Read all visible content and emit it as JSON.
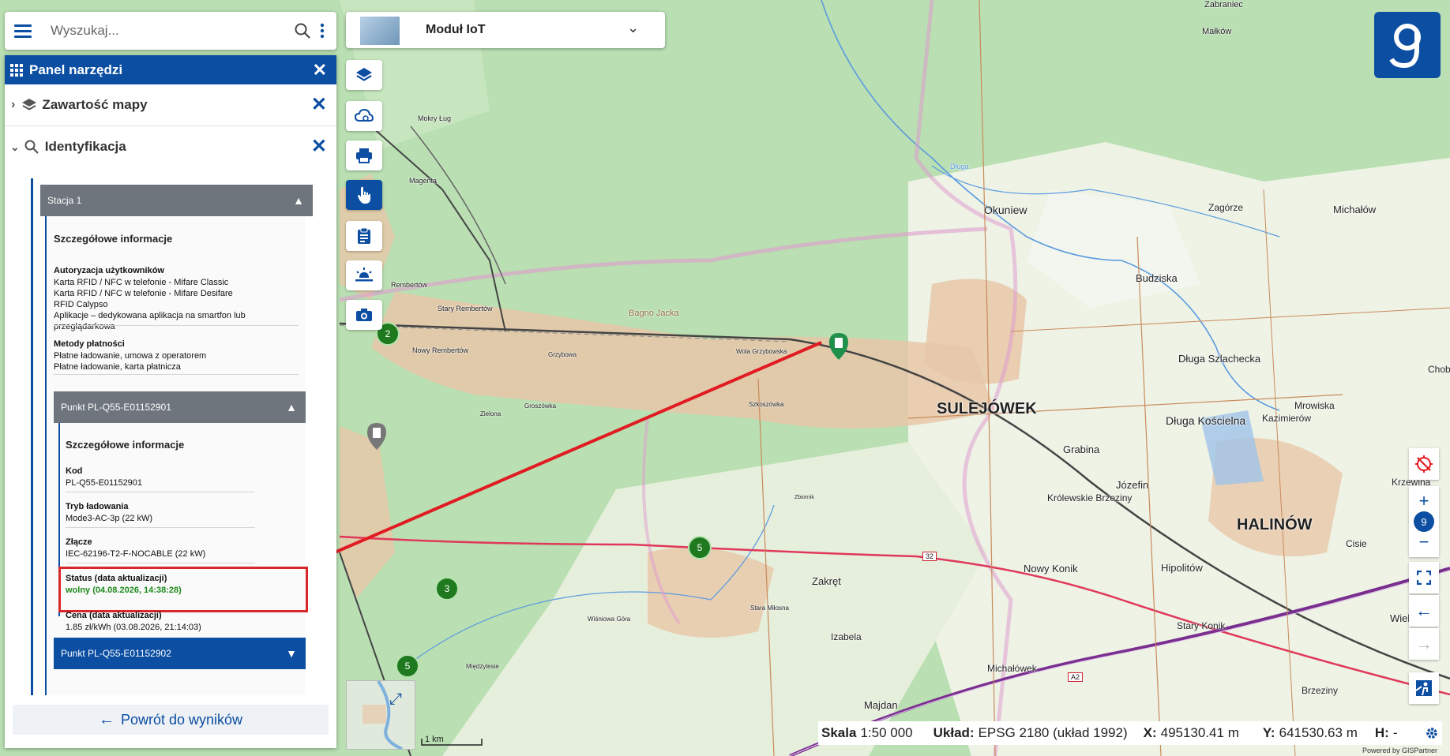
{
  "search": {
    "placeholder": "Wyszukaj..."
  },
  "panel": {
    "title": "Panel narzędzi",
    "sections": [
      {
        "label": "Zawartość mapy"
      },
      {
        "label": "Identyfikacja"
      }
    ],
    "station": {
      "title": "Stacja 1",
      "details_title": "Szczegółowe informacje",
      "auth_label": "Autoryzacja użytkowników",
      "auth_values": [
        "Karta RFID / NFC w telefonie - Mifare Classic",
        "Karta RFID / NFC w telefonie - Mifare Desifare",
        "RFID Calypso",
        "Aplikacje – dedykowana aplikacja na smartfon lub przeglądarkowa"
      ],
      "payment_label": "Metody płatności",
      "payment_values": [
        "Płatne ładowanie, umowa z operatorem",
        "Płatne ładowanie, karta płatnicza"
      ]
    },
    "point1": {
      "title": "Punkt PL-Q55-E01152901",
      "details_title": "Szczegółowe informacje",
      "fields": [
        {
          "label": "Kod",
          "value": "PL-Q55-E01152901"
        },
        {
          "label": "Tryb ładowania",
          "value": "Mode3-AC-3p (22 kW)"
        },
        {
          "label": "Złącze",
          "value": "IEC-62196-T2-F-NOCABLE (22 kW)"
        },
        {
          "label": "Status (data aktualizacji)",
          "value": "wolny (04.08.2026, 14:38:28)"
        },
        {
          "label": "Cena (data aktualizacji)",
          "value": "1.85 zł/kWh (03.08.2026, 21:14:03)"
        }
      ]
    },
    "point2": {
      "title": "Punkt PL-Q55-E01152902"
    },
    "back_label": "Powrót do wyników"
  },
  "module": {
    "label": "Moduł IoT"
  },
  "map": {
    "places": [
      {
        "name": "SULEJÓWEK"
      },
      {
        "name": "HALINÓW"
      },
      {
        "name": "Okuniew"
      },
      {
        "name": "Zagórze"
      },
      {
        "name": "Michałów"
      },
      {
        "name": "Budziska"
      },
      {
        "name": "Długa Szlachecka"
      },
      {
        "name": "Długa Kościelna"
      },
      {
        "name": "Kazimierów"
      },
      {
        "name": "Mrowiska"
      },
      {
        "name": "Grabina"
      },
      {
        "name": "Józefin"
      },
      {
        "name": "Królewskie Brzeziny"
      },
      {
        "name": "Nowy Konik"
      },
      {
        "name": "Hipolitów"
      },
      {
        "name": "Zakręt"
      },
      {
        "name": "Stary Konik"
      },
      {
        "name": "Izabela"
      },
      {
        "name": "Michałówek"
      },
      {
        "name": "Majdan"
      },
      {
        "name": "Brzeziny"
      },
      {
        "name": "Cisie"
      },
      {
        "name": "Wielgo"
      },
      {
        "name": "Krzewina"
      },
      {
        "name": "Chobo"
      },
      {
        "name": "Małków"
      },
      {
        "name": "Zabraniec"
      },
      {
        "name": "Mokry Ług"
      },
      {
        "name": "Magenta"
      },
      {
        "name": "Rembertów"
      },
      {
        "name": "Stary Rembertów"
      },
      {
        "name": "Nowy Rembertów"
      },
      {
        "name": "Bagno Jacka"
      },
      {
        "name": "Grzybowa"
      },
      {
        "name": "Wola Grzybowska"
      },
      {
        "name": "Zielona"
      },
      {
        "name": "Groszówka"
      },
      {
        "name": "Szkoszówka"
      },
      {
        "name": "Stara Miłosna"
      },
      {
        "name": "Wiśniowa Góra"
      },
      {
        "name": "Międzylesie"
      },
      {
        "name": "Długa"
      },
      {
        "name": "Zbiornik"
      }
    ],
    "clusters": [
      {
        "count": "2"
      },
      {
        "count": "5"
      },
      {
        "count": "3"
      },
      {
        "count": "5"
      }
    ],
    "road_label": "32",
    "motorway_label": "A2",
    "scale_bar_label": "1 km"
  },
  "zoom": {
    "level": "9",
    "plus": "+",
    "minus": "−"
  },
  "status_bar": {
    "scale_label": "Skala",
    "scale_value": "1:50 000",
    "crs_label": "Układ:",
    "crs_value": "EPSG 2180 (układ 1992)",
    "x_label": "X:",
    "x_value": "495130.41 m",
    "y_label": "Y:",
    "y_value": "641530.63 m",
    "h_label": "H:",
    "h_value": "-"
  },
  "powered_by": "Powered by GISPartner",
  "colors": {
    "accent": "#0b4ea2",
    "forest": "#b9dfb2",
    "field": "#eef3e6",
    "urban": "#e8c7a8",
    "highlight": "#d9262b",
    "status_free": "#1e8a1e"
  }
}
